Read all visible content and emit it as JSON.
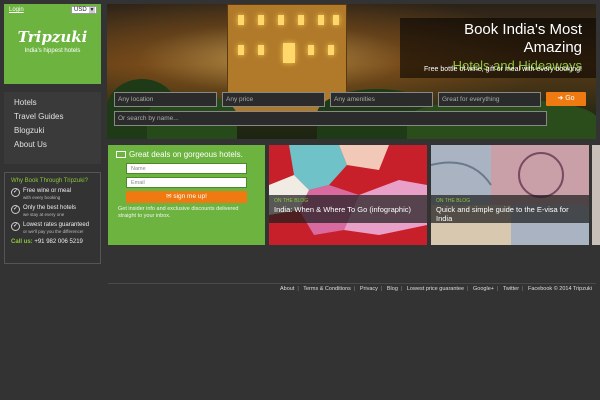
{
  "header": {
    "login": "Login",
    "currency": "USD"
  },
  "logo": {
    "name": "Tripzuki",
    "tagline": "India's hippest hotels"
  },
  "nav": {
    "items": [
      "Hotels",
      "Travel Guides",
      "Blogzuki",
      "About Us"
    ]
  },
  "why": {
    "title": "Why Book Through Tripzuki?",
    "perks": [
      {
        "main": "Free wine or meal",
        "sub": "with every booking"
      },
      {
        "main": "Only the best hotels",
        "sub": "we stay at every one"
      },
      {
        "main": "Lowest rates guaranteed",
        "sub": "or we'll pay you the difference!"
      }
    ],
    "call_label": "Call us:",
    "call_number": "+91 982 006 5219"
  },
  "hero": {
    "headline1": "Book India's Most Amazing",
    "headline2": "Hotels and Hideaways",
    "subline": "Free bottle of wine, gift or meal with every booking!"
  },
  "search": {
    "location": "Any location",
    "price": "Any price",
    "amenities": "Any amenities",
    "purpose": "Great for everything",
    "go": "Go",
    "name_placeholder": "Or search by name..."
  },
  "newsletter": {
    "title": "Great deals on gorgeous hotels.",
    "name_placeholder": "Name",
    "email_placeholder": "Email",
    "button": "sign me up!",
    "note": "Get insider info and exclusive discounts delivered straight to your inbox."
  },
  "blog": [
    {
      "label": "ON THE BLOG",
      "title": "India: When & Where To Go (infographic)"
    },
    {
      "label": "ON THE BLOG",
      "title": "Quick and simple guide to the E-visa for India"
    }
  ],
  "footer": {
    "links": [
      "About",
      "Terms & Conditions",
      "Privacy",
      "Blog",
      "Lowest price guarantee",
      "Google+",
      "Twitter",
      "Facebook"
    ],
    "copyright": "© 2014 Tripzuki"
  },
  "colors": {
    "brand_green": "#6cb33f",
    "accent_orange": "#f07a12",
    "background": "#333333"
  }
}
